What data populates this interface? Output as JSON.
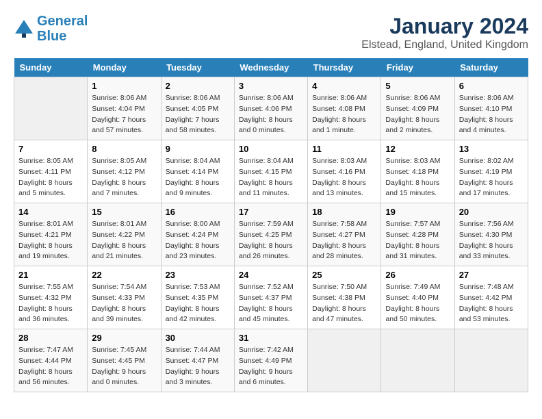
{
  "header": {
    "logo_line1": "General",
    "logo_line2": "Blue",
    "title": "January 2024",
    "subtitle": "Elstead, England, United Kingdom"
  },
  "calendar": {
    "days_of_week": [
      "Sunday",
      "Monday",
      "Tuesday",
      "Wednesday",
      "Thursday",
      "Friday",
      "Saturday"
    ],
    "weeks": [
      [
        {
          "day": "",
          "info": ""
        },
        {
          "day": "1",
          "info": "Sunrise: 8:06 AM\nSunset: 4:04 PM\nDaylight: 7 hours\nand 57 minutes."
        },
        {
          "day": "2",
          "info": "Sunrise: 8:06 AM\nSunset: 4:05 PM\nDaylight: 7 hours\nand 58 minutes."
        },
        {
          "day": "3",
          "info": "Sunrise: 8:06 AM\nSunset: 4:06 PM\nDaylight: 8 hours\nand 0 minutes."
        },
        {
          "day": "4",
          "info": "Sunrise: 8:06 AM\nSunset: 4:08 PM\nDaylight: 8 hours\nand 1 minute."
        },
        {
          "day": "5",
          "info": "Sunrise: 8:06 AM\nSunset: 4:09 PM\nDaylight: 8 hours\nand 2 minutes."
        },
        {
          "day": "6",
          "info": "Sunrise: 8:06 AM\nSunset: 4:10 PM\nDaylight: 8 hours\nand 4 minutes."
        }
      ],
      [
        {
          "day": "7",
          "info": "Sunrise: 8:05 AM\nSunset: 4:11 PM\nDaylight: 8 hours\nand 5 minutes."
        },
        {
          "day": "8",
          "info": "Sunrise: 8:05 AM\nSunset: 4:12 PM\nDaylight: 8 hours\nand 7 minutes."
        },
        {
          "day": "9",
          "info": "Sunrise: 8:04 AM\nSunset: 4:14 PM\nDaylight: 8 hours\nand 9 minutes."
        },
        {
          "day": "10",
          "info": "Sunrise: 8:04 AM\nSunset: 4:15 PM\nDaylight: 8 hours\nand 11 minutes."
        },
        {
          "day": "11",
          "info": "Sunrise: 8:03 AM\nSunset: 4:16 PM\nDaylight: 8 hours\nand 13 minutes."
        },
        {
          "day": "12",
          "info": "Sunrise: 8:03 AM\nSunset: 4:18 PM\nDaylight: 8 hours\nand 15 minutes."
        },
        {
          "day": "13",
          "info": "Sunrise: 8:02 AM\nSunset: 4:19 PM\nDaylight: 8 hours\nand 17 minutes."
        }
      ],
      [
        {
          "day": "14",
          "info": "Sunrise: 8:01 AM\nSunset: 4:21 PM\nDaylight: 8 hours\nand 19 minutes."
        },
        {
          "day": "15",
          "info": "Sunrise: 8:01 AM\nSunset: 4:22 PM\nDaylight: 8 hours\nand 21 minutes."
        },
        {
          "day": "16",
          "info": "Sunrise: 8:00 AM\nSunset: 4:24 PM\nDaylight: 8 hours\nand 23 minutes."
        },
        {
          "day": "17",
          "info": "Sunrise: 7:59 AM\nSunset: 4:25 PM\nDaylight: 8 hours\nand 26 minutes."
        },
        {
          "day": "18",
          "info": "Sunrise: 7:58 AM\nSunset: 4:27 PM\nDaylight: 8 hours\nand 28 minutes."
        },
        {
          "day": "19",
          "info": "Sunrise: 7:57 AM\nSunset: 4:28 PM\nDaylight: 8 hours\nand 31 minutes."
        },
        {
          "day": "20",
          "info": "Sunrise: 7:56 AM\nSunset: 4:30 PM\nDaylight: 8 hours\nand 33 minutes."
        }
      ],
      [
        {
          "day": "21",
          "info": "Sunrise: 7:55 AM\nSunset: 4:32 PM\nDaylight: 8 hours\nand 36 minutes."
        },
        {
          "day": "22",
          "info": "Sunrise: 7:54 AM\nSunset: 4:33 PM\nDaylight: 8 hours\nand 39 minutes."
        },
        {
          "day": "23",
          "info": "Sunrise: 7:53 AM\nSunset: 4:35 PM\nDaylight: 8 hours\nand 42 minutes."
        },
        {
          "day": "24",
          "info": "Sunrise: 7:52 AM\nSunset: 4:37 PM\nDaylight: 8 hours\nand 45 minutes."
        },
        {
          "day": "25",
          "info": "Sunrise: 7:50 AM\nSunset: 4:38 PM\nDaylight: 8 hours\nand 47 minutes."
        },
        {
          "day": "26",
          "info": "Sunrise: 7:49 AM\nSunset: 4:40 PM\nDaylight: 8 hours\nand 50 minutes."
        },
        {
          "day": "27",
          "info": "Sunrise: 7:48 AM\nSunset: 4:42 PM\nDaylight: 8 hours\nand 53 minutes."
        }
      ],
      [
        {
          "day": "28",
          "info": "Sunrise: 7:47 AM\nSunset: 4:44 PM\nDaylight: 8 hours\nand 56 minutes."
        },
        {
          "day": "29",
          "info": "Sunrise: 7:45 AM\nSunset: 4:45 PM\nDaylight: 9 hours\nand 0 minutes."
        },
        {
          "day": "30",
          "info": "Sunrise: 7:44 AM\nSunset: 4:47 PM\nDaylight: 9 hours\nand 3 minutes."
        },
        {
          "day": "31",
          "info": "Sunrise: 7:42 AM\nSunset: 4:49 PM\nDaylight: 9 hours\nand 6 minutes."
        },
        {
          "day": "",
          "info": ""
        },
        {
          "day": "",
          "info": ""
        },
        {
          "day": "",
          "info": ""
        }
      ]
    ]
  }
}
